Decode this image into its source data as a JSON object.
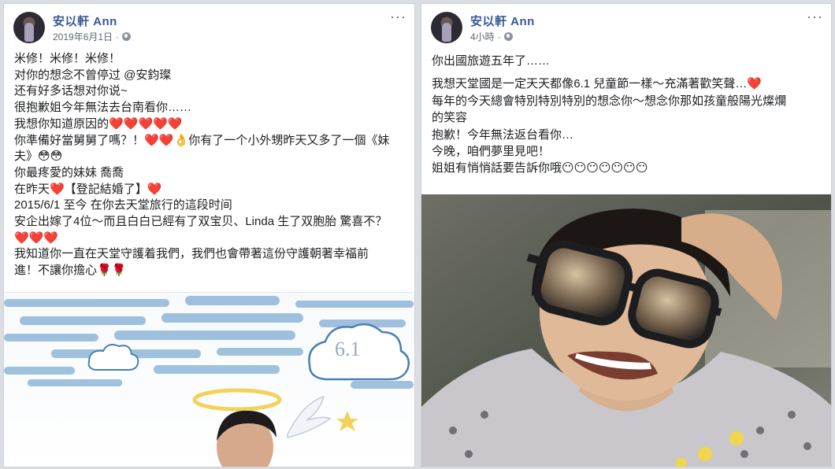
{
  "left_post": {
    "author": "安以軒 Ann",
    "timestamp": "2019年6月1日",
    "more_label": "···",
    "lines": [
      "米修！米修！米修！",
      "对你的想念不曾停过 @安鈞璨",
      "还有好多话想对你说~",
      "很抱歉姐今年無法去台南看你……",
      "我想你知道原因的❤️❤️❤️❤️❤️",
      "你準備好當舅舅了嗎？！❤️❤️👌你有了一个小外甥昨天又多了一個《妹",
      "夫》😳😳",
      "你最疼愛的妹妹 喬喬",
      "在昨天❤️【登記結婚了】❤️",
      "2015/6/1 至今 在你去天堂旅行的這段时间",
      "安企出嫁了4位～而且白白已經有了双宝贝、Linda 生了双胞胎 驚喜不？",
      "❤️❤️❤️",
      "我知道你一直在天堂守護着我們，我們也會帶著這份守護朝著幸福前",
      "進！不讓你擔心🌹🌹"
    ],
    "illustration": {
      "cloud_label": "6.1",
      "sky_color": "#8fb7d9",
      "halo_color": "#f2d25a"
    }
  },
  "right_post": {
    "author": "安以軒 Ann",
    "timestamp": "4小時",
    "more_label": "···",
    "lines": [
      "你出國旅遊五年了……",
      "我想天堂國是一定天天都像6.1 兒童節一樣～充滿著歡笑聲…❤️",
      "每年的今天總會特別特別特別的想念你～想念你那如孩童般陽光燦爛",
      "的笑容",
      "抱歉！今年無法返台看你…",
      "今晚，咱們夢里見吧！",
      "姐姐有悄悄話要告訴你哦😶😶😶😶😶😶😶"
    ],
    "photo": {
      "hoodie_color": "#c9c6cc",
      "sunglasses_color": "#1d1d1f"
    }
  }
}
